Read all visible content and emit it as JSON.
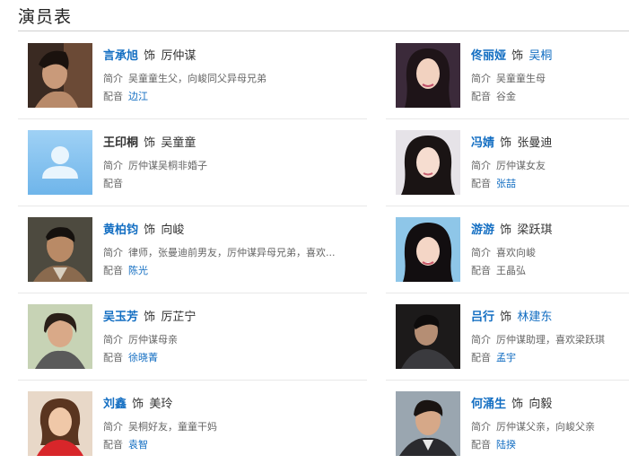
{
  "page_title": "演员表",
  "labels": {
    "shi": "饰",
    "intro": "简介",
    "voice": "配音"
  },
  "left": [
    {
      "actor": "言承旭",
      "actor_link": true,
      "role": "厉仲谋",
      "role_link": false,
      "intro": "吴童童生父，向峻同父异母兄弟",
      "voice": "边江",
      "voice_link": true,
      "photo": "portrait-photo-1"
    },
    {
      "actor": "王印桐",
      "actor_link": false,
      "role": "吴童童",
      "role_link": false,
      "intro": "厉仲谋吴桐非婚子",
      "voice": "",
      "voice_link": false,
      "photo": "default-avatar"
    },
    {
      "actor": "黄柏钧",
      "actor_link": true,
      "role": "向峻",
      "role_link": false,
      "intro": "律师，张曼迪前男友，厉仲谋异母兄弟，喜欢...",
      "voice": "陈光",
      "voice_link": true,
      "photo": "portrait-photo-3"
    },
    {
      "actor": "吴玉芳",
      "actor_link": true,
      "role": "厉芷宁",
      "role_link": false,
      "intro": "厉仲谋母亲",
      "voice": "徐晓菁",
      "voice_link": true,
      "photo": "portrait-photo-4"
    },
    {
      "actor": "刘鑫",
      "actor_link": true,
      "role": "美玲",
      "role_link": false,
      "intro": "吴桐好友，童童干妈",
      "voice": "袁智",
      "voice_link": true,
      "photo": "portrait-photo-5"
    }
  ],
  "right": [
    {
      "actor": "佟丽娅",
      "actor_link": true,
      "role": "吴桐",
      "role_link": true,
      "intro": "吴童童生母",
      "voice": "谷金",
      "voice_link": false,
      "photo": "portrait-photo-6"
    },
    {
      "actor": "冯婧",
      "actor_link": true,
      "role": "张曼迪",
      "role_link": false,
      "intro": "厉仲谋女友",
      "voice": "张喆",
      "voice_link": true,
      "photo": "portrait-photo-7"
    },
    {
      "actor": "游游",
      "actor_link": true,
      "role": "梁跃琪",
      "role_link": false,
      "intro": "喜欢向峻",
      "voice": "王晶弘",
      "voice_link": false,
      "photo": "portrait-photo-8"
    },
    {
      "actor": "吕行",
      "actor_link": true,
      "role": "林建东",
      "role_link": true,
      "intro": "厉仲谋助理，喜欢梁跃琪",
      "voice": "孟宇",
      "voice_link": true,
      "photo": "portrait-photo-9"
    },
    {
      "actor": "何涌生",
      "actor_link": true,
      "role": "向毅",
      "role_link": false,
      "intro": "厉仲谋父亲，向峻父亲",
      "voice": "陆揆",
      "voice_link": true,
      "photo": "portrait-photo-10"
    }
  ],
  "colors": {
    "link": "#136ec2",
    "text": "#333333",
    "muted": "#666666",
    "divider": "#e8e8e8"
  }
}
